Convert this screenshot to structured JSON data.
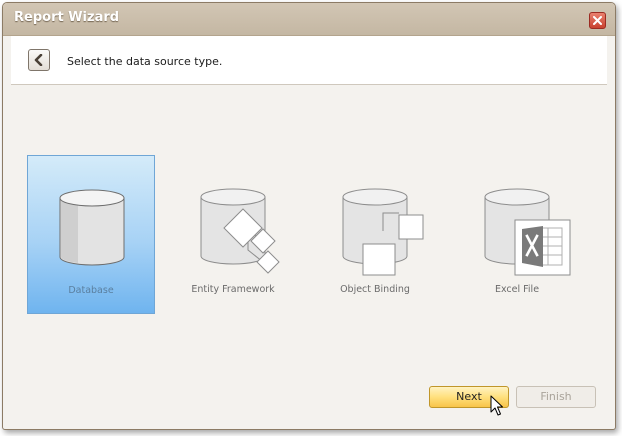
{
  "window": {
    "title": "Report Wizard"
  },
  "header": {
    "instruction": "Select the data source type."
  },
  "data_sources": [
    {
      "label": "Database",
      "icon": "database-icon",
      "selected": true
    },
    {
      "label": "Entity Framework",
      "icon": "entity-framework-icon",
      "selected": false
    },
    {
      "label": "Object Binding",
      "icon": "object-binding-icon",
      "selected": false
    },
    {
      "label": "Excel File",
      "icon": "excel-file-icon",
      "selected": false
    }
  ],
  "footer": {
    "next_label": "Next",
    "finish_label": "Finish"
  },
  "colors": {
    "selection_top": "#d4ebf9",
    "selection_bottom": "#6fb4ef",
    "next_button": "#ffe07e",
    "excel_green": "#1d6f42"
  }
}
